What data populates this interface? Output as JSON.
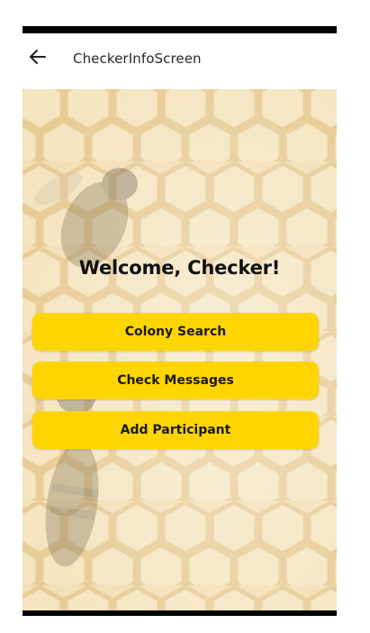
{
  "app_bar": {
    "title": "CheckerInfoScreen",
    "back_icon": "arrow-left-icon"
  },
  "main": {
    "welcome_text": "Welcome, Checker!",
    "buttons": [
      {
        "label": "Colony Search"
      },
      {
        "label": "Check Messages"
      },
      {
        "label": "Add Participant"
      }
    ],
    "background_image": "honeycomb-with-bees"
  },
  "colors": {
    "button_bg": "#ffd500",
    "button_text": "#1a1a1a",
    "background_tint": "#efd9a8",
    "status_bar": "#000000"
  }
}
